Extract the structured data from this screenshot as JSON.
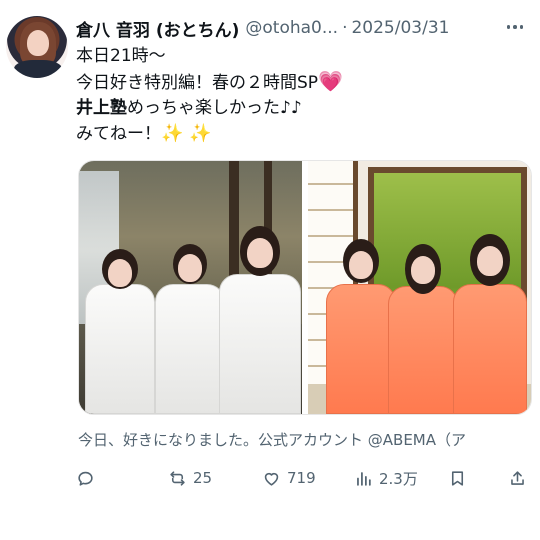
{
  "author": {
    "display_name": "倉八 音羽 (おとちん)",
    "handle": "@otoha0...",
    "separator": "·",
    "date": "2025/03/31"
  },
  "post": {
    "lines": [
      "本日21時〜",
      "今日好き特別編！春の２時間SP",
      "めっちゃ楽しかった♪♪",
      "みてねー！"
    ],
    "bold_prefix": "井上塾",
    "heart_emoji": "💗",
    "sparkles": "✨ ✨"
  },
  "media": {
    "caption": "今日、好きになりました。公式アカウント @ABEMA（ア"
  },
  "actions": {
    "reply_count": "",
    "retweet_count": "25",
    "like_count": "719",
    "views_count": "2.3万"
  },
  "colors": {
    "text": "#0f1419",
    "secondary": "#536471",
    "heart": "#ff3aa3"
  },
  "icons": [
    "avatar",
    "more-icon",
    "reply-icon",
    "retweet-icon",
    "like-icon",
    "views-icon",
    "bookmark-icon",
    "share-icon"
  ]
}
